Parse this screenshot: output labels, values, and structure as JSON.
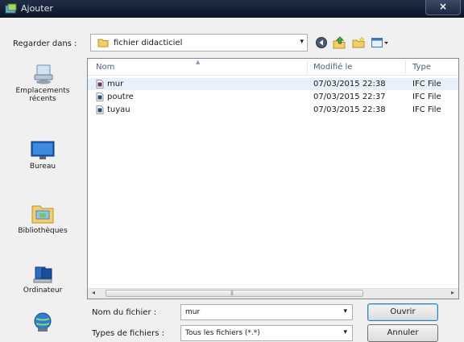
{
  "window": {
    "title": "Ajouter",
    "close_glyph": "×"
  },
  "look_in": {
    "label": "Regarder dans :",
    "value": "fichier didacticiel",
    "arrow": "▾"
  },
  "toolbar": {
    "icons": [
      "back-icon",
      "up-folder-icon",
      "new-folder-icon",
      "view-menu-icon"
    ]
  },
  "places": [
    {
      "label": "Emplacements récents",
      "icon": "recent-places-icon"
    },
    {
      "label": "Bureau",
      "icon": "desktop-icon"
    },
    {
      "label": "Bibliothèques",
      "icon": "libraries-icon"
    },
    {
      "label": "Ordinateur",
      "icon": "computer-icon"
    },
    {
      "label": "",
      "icon": "network-icon"
    }
  ],
  "file_list": {
    "columns": {
      "name": "Nom",
      "modified": "Modifié le",
      "type": "Type"
    },
    "rows": [
      {
        "name": "mur",
        "modified": "07/03/2015 22:38",
        "type": "IFC File",
        "selected": true
      },
      {
        "name": "poutre",
        "modified": "07/03/2015 22:37",
        "type": "IFC File",
        "selected": false
      },
      {
        "name": "tuyau",
        "modified": "07/03/2015 22:38",
        "type": "IFC File",
        "selected": false
      }
    ],
    "scroll_left": "◂",
    "scroll_right": "▸",
    "grip": "|||"
  },
  "filename": {
    "label": "Nom du fichier :",
    "value": "mur",
    "arrow": "▾"
  },
  "filetype": {
    "label": "Types de fichiers :",
    "value": "Tous les fichiers (*.*)",
    "arrow": "▾"
  },
  "buttons": {
    "open": "Ouvrir",
    "cancel": "Annuler"
  },
  "colors": {
    "titlebar": "#0c1526",
    "header_text": "#4d6185",
    "selection": "#e8f1fb"
  }
}
